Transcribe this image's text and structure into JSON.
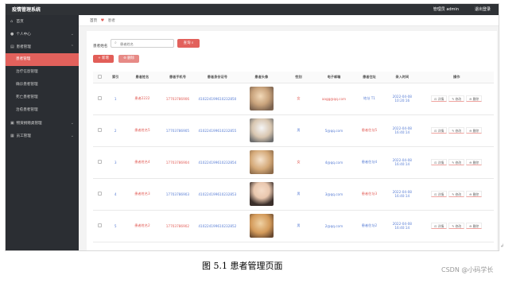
{
  "header": {
    "app_title": "疫情管理系统",
    "admin_label": "管理员 admin",
    "logout_label": "退出登录"
  },
  "sidebar": {
    "items": [
      {
        "label": "首页",
        "icon": "home-icon"
      },
      {
        "label": "个人中心",
        "icon": "user-icon"
      },
      {
        "label": "患者管理",
        "icon": "patient-icon",
        "active": true
      },
      {
        "label": "患者管理",
        "sub": true,
        "active": true
      },
      {
        "label": "治疗信息管理",
        "sub": true
      },
      {
        "label": "确诊患者管理",
        "sub": true
      },
      {
        "label": "死亡患者管理",
        "sub": true
      },
      {
        "label": "治愈患者管理",
        "sub": true
      },
      {
        "label": "物资捐赠类管理",
        "icon": "box-icon"
      },
      {
        "label": "员工管理",
        "icon": "staff-icon"
      }
    ]
  },
  "breadcrumb": {
    "home": "首页",
    "current": "患者"
  },
  "search": {
    "label": "患者姓名",
    "placeholder": "患者姓名",
    "button_label": "查询"
  },
  "actions": {
    "add_label": "新增",
    "delete_label": "删除"
  },
  "table": {
    "columns": [
      "索引",
      "患者姓名",
      "患者手机号",
      "患者身份证号",
      "患者头像",
      "性别",
      "电子邮箱",
      "患者住址",
      "录入时间",
      "操作"
    ],
    "rows": [
      {
        "index": "1",
        "name": "患者2222",
        "phone": "17703786906",
        "id": "410224199610232850",
        "gender": "女",
        "email": "aagg@qq.com",
        "address": "地址 T1",
        "time": "2022-04-08 10:20:16"
      },
      {
        "index": "2",
        "name": "患者姓名5",
        "phone": "17703786905",
        "id": "410224199610232855",
        "gender": "男",
        "email": "5@qq.com",
        "address": "患者住址5",
        "time": "2022-04-08 16:40:14"
      },
      {
        "index": "3",
        "name": "患者姓名4",
        "phone": "17703786904",
        "id": "410224199610232854",
        "gender": "女",
        "email": "4@qq.com",
        "address": "患者住址4",
        "time": "2022-04-08 16:40:14"
      },
      {
        "index": "4",
        "name": "患者姓名3",
        "phone": "17703786903",
        "id": "410224199610232853",
        "gender": "男",
        "email": "3@qq.com",
        "address": "患者住址3",
        "time": "2022-04-08 16:40:14"
      },
      {
        "index": "5",
        "name": "患者姓名2",
        "phone": "17703786902",
        "id": "410224199610232852",
        "gender": "男",
        "email": "2@qq.com",
        "address": "患者住址2",
        "time": "2022-04-08 16:40:14"
      }
    ],
    "op_labels": {
      "detail": "详情",
      "edit": "修改",
      "delete": "删除"
    }
  },
  "caption": "图 5.1 患者管理页面",
  "watermark": "CSDN @小码学长",
  "colors": {
    "accent": "#e25e58",
    "sidebar": "#2b2e33",
    "topbar": "#2f3236",
    "link": "#5a7fd5"
  }
}
